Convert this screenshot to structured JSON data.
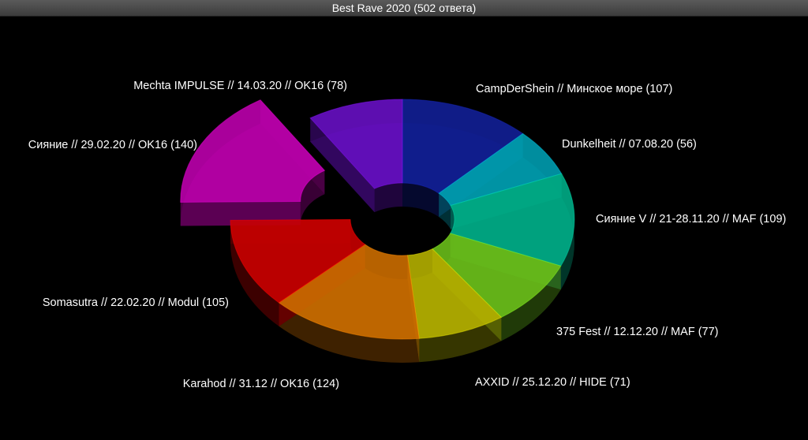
{
  "window": {
    "title": "Best Rave 2020 (502 ответа)"
  },
  "chart_data": {
    "type": "pie",
    "variant": "3d-donut",
    "series": [
      {
        "label": "CampDerShein // Минское море (107)",
        "value": 107,
        "color": "#12209a"
      },
      {
        "label": "Dunkelheit // 07.08.20 (56)",
        "value": 56,
        "color": "#00a0b4"
      },
      {
        "label": "Сияние V // 21-28.11.20 // MAF (109)",
        "value": 109,
        "color": "#00b08a"
      },
      {
        "label": "375 Fest // 12.12.20 // MAF (77)",
        "value": 77,
        "color": "#6cc21a"
      },
      {
        "label": "AXXID // 25.12.20 // HIDE (71)",
        "value": 71,
        "color": "#b8b400"
      },
      {
        "label": "Karahod // 31.12 // OK16 (124)",
        "value": 124,
        "color": "#d07000"
      },
      {
        "label": "Somasutra // 22.02.20 // Modul (105)",
        "value": 105,
        "color": "#cc0000"
      },
      {
        "label": "Сияние // 29.02.20 // OK16 (140)",
        "value": 140,
        "color": "#c000b0",
        "exploded": true
      },
      {
        "label": "Mechta IMPULSE // 14.03.20 // OK16 (78)",
        "value": 78,
        "color": "#6a10c8"
      }
    ]
  }
}
